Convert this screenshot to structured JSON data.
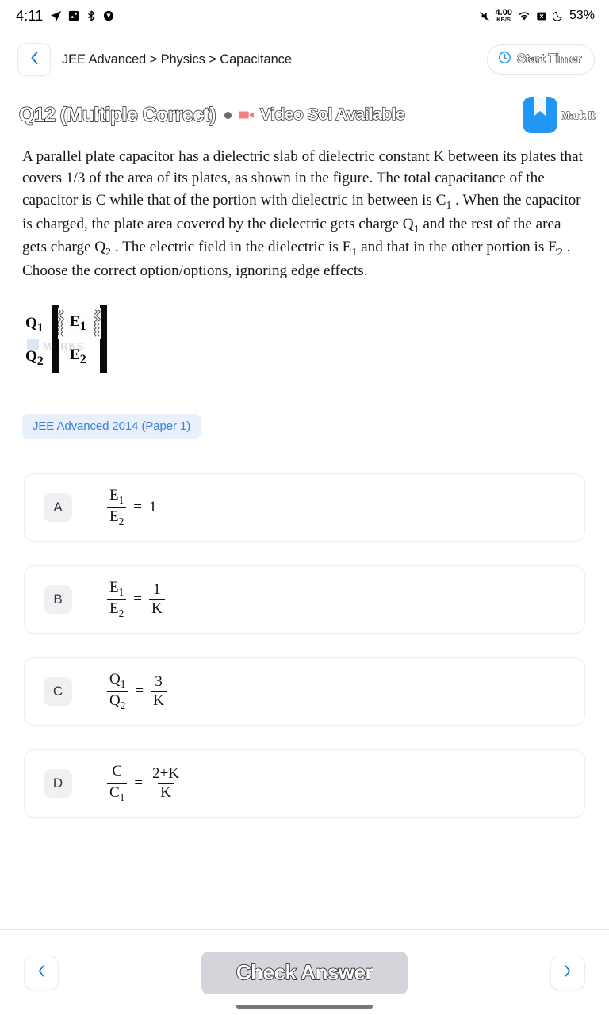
{
  "status_bar": {
    "time": "4:11",
    "left_icons": [
      "navigation-icon",
      "image-icon",
      "bluetooth-icon",
      "app-icon"
    ],
    "net_speed_value": "4.00",
    "net_speed_unit": "KB/S",
    "right_icons": [
      "mute-icon",
      "wifi-icon",
      "cast-icon",
      "do-not-disturb-icon"
    ],
    "battery": "53%"
  },
  "header": {
    "back_icon": "chevron-left-icon",
    "breadcrumb": "JEE Advanced > Physics > Capacitance",
    "timer_icon": "clock-icon",
    "timer_label": "Start Timer"
  },
  "question": {
    "number_label": "Q12 (Multiple Correct)",
    "video_icon": "video-camera-icon",
    "video_label": "Video Sol Available",
    "mark_icon": "bookmark-icon",
    "mark_label": "Mark It",
    "text_line1": "A parallel plate capacitor has a dielectric slab of dielectric constant K between its",
    "text_line2": "plates that covers 1/3 of the area of its plates, as shown in the figure. The total",
    "text_line3": "capacitance of the capacitor is C while that of the portion with dielectric in",
    "text_line4_a": "between is C",
    "text_line4_sub": "1",
    "text_line4_b": ". When the capacitor is charged, the plate area covered by the",
    "text_line5_a": "dielectric gets charge Q",
    "text_line5_sub1": "1",
    "text_line5_b": " and the rest of the area gets charge Q",
    "text_line5_sub2": "2",
    "text_line5_c": ". The electric",
    "text_line6_a": "field in the dielectric is E",
    "text_line6_sub1": "1",
    "text_line6_b": " and that in the other portion is E",
    "text_line6_sub2": "2",
    "text_line6_c": ". Choose the correct",
    "text_line7": "option/options, ignoring edge effects.",
    "source_tag": "JEE Advanced 2014 (Paper 1)"
  },
  "figure": {
    "label_q1": "Q",
    "label_q1_sub": "1",
    "label_q2": "Q",
    "label_q2_sub": "2",
    "label_e1": "E",
    "label_e1_sub": "1",
    "label_e2": "E",
    "label_e2_sub": "2",
    "watermark": "MARKS"
  },
  "options": [
    {
      "letter": "A",
      "num": "E",
      "num_sub": "1",
      "den": "E",
      "den_sub": "2",
      "equals": "=",
      "rhs_type": "plain",
      "rhs": "1"
    },
    {
      "letter": "B",
      "num": "E",
      "num_sub": "1",
      "den": "E",
      "den_sub": "2",
      "equals": "=",
      "rhs_type": "fraction",
      "rhs_num": "1",
      "rhs_den": "K"
    },
    {
      "letter": "C",
      "num": "Q",
      "num_sub": "1",
      "den": "Q",
      "den_sub": "2",
      "equals": "=",
      "rhs_type": "fraction",
      "rhs_num": "3",
      "rhs_den": "K"
    },
    {
      "letter": "D",
      "num": "C",
      "num_sub": "",
      "den": "C",
      "den_sub": "1",
      "equals": "=",
      "rhs_type": "fraction",
      "rhs_num": "2+K",
      "rhs_den": "K"
    }
  ],
  "bottom_bar": {
    "prev_icon": "chevron-left-icon",
    "check_label": "Check Answer",
    "next_icon": "chevron-right-icon"
  },
  "colors": {
    "accent_blue": "#2196f3",
    "tag_bg": "#e8f0fb",
    "tag_text": "#3d7fd6",
    "check_bg": "#d3d5da",
    "video_icon": "#f08080"
  }
}
